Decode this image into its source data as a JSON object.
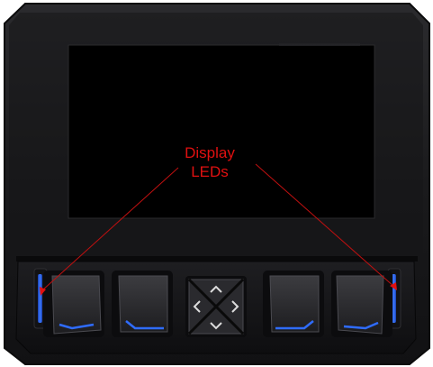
{
  "annotation": {
    "line1": "Display",
    "line2": "LEDs",
    "color": "#e01010"
  },
  "colors": {
    "bezel": "#1c1c1e",
    "screen": "#000000",
    "button": "#2a2a2d",
    "led": "#2a5fe0"
  },
  "buttons": [
    {
      "name": "soft-key-1",
      "icon": "corner-bracket-icon"
    },
    {
      "name": "soft-key-2",
      "icon": "corner-bracket-icon"
    },
    {
      "name": "dpad",
      "icons": [
        "chevron-up-icon",
        "chevron-left-icon",
        "chevron-right-icon",
        "chevron-down-icon"
      ]
    },
    {
      "name": "soft-key-3",
      "icon": "corner-bracket-icon"
    },
    {
      "name": "soft-key-4",
      "icon": "corner-bracket-icon"
    }
  ]
}
